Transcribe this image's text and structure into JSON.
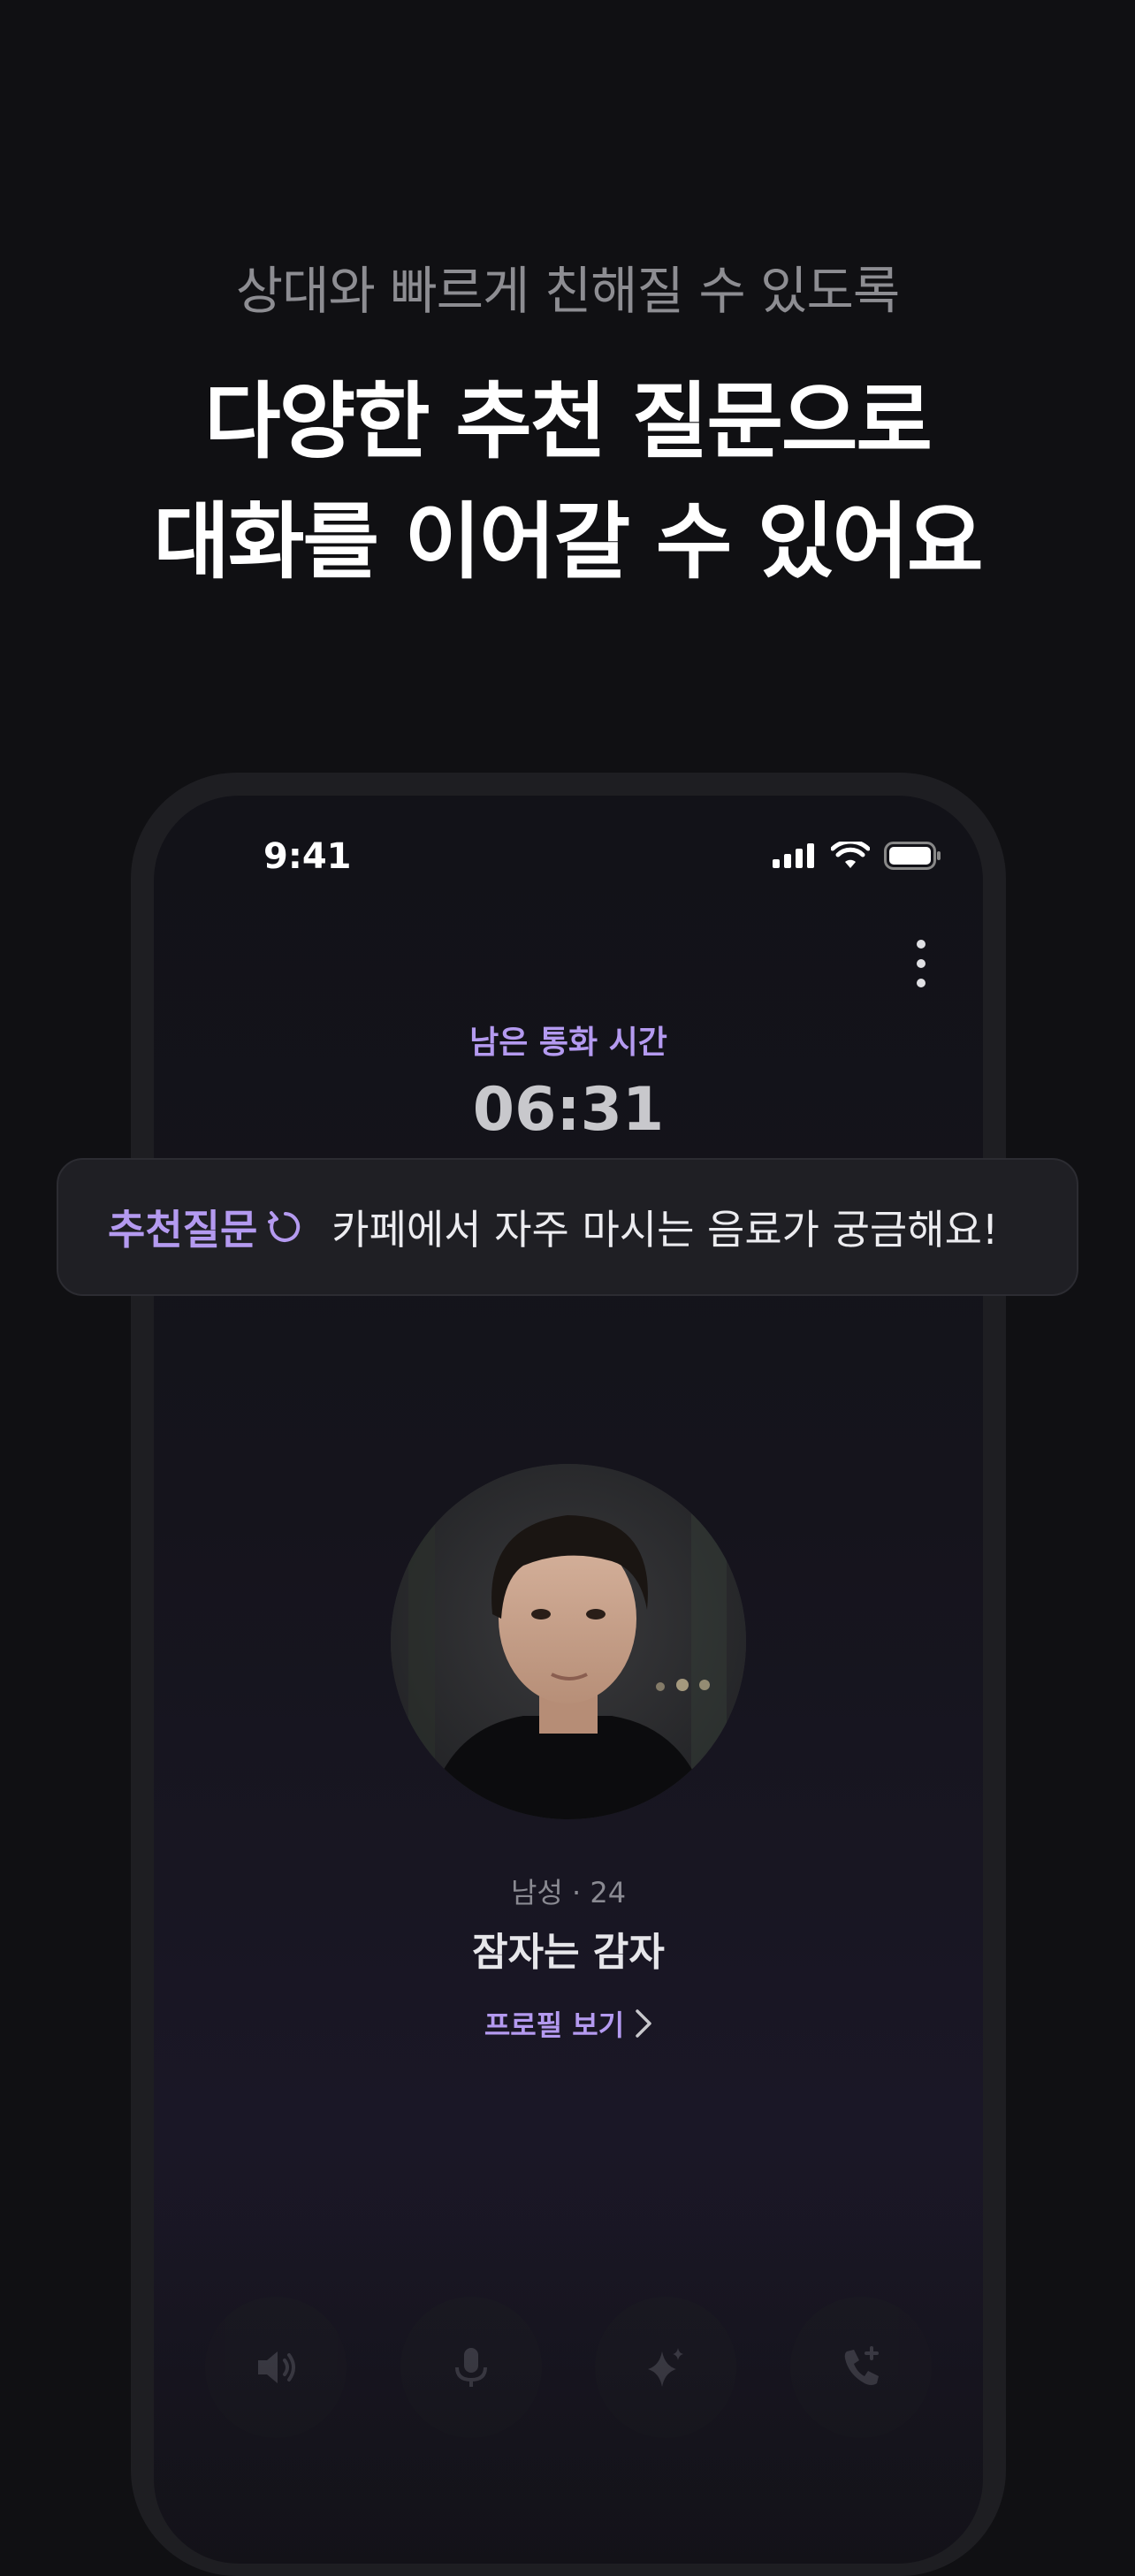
{
  "promo": {
    "subtitle": "상대와 빠르게 친해질 수 있도록",
    "title_line1": "다양한 추천 질문으로",
    "title_line2": "대화를 이어갈 수 있어요"
  },
  "status_bar": {
    "time": "9:41"
  },
  "call": {
    "remaining_label": "남은 통화 시간",
    "remaining_time": "06:31"
  },
  "suggestion": {
    "tag": "추천질문",
    "question": "카페에서 자주 마시는 음료가 궁금해요!"
  },
  "profile": {
    "meta": "남성 · 24",
    "name": "잠자는 감자",
    "link_label": "프로필 보기"
  },
  "controls": [
    {
      "icon": "speaker-icon"
    },
    {
      "icon": "microphone-icon"
    },
    {
      "icon": "sparkle-icon"
    },
    {
      "icon": "add-call-icon"
    }
  ],
  "colors": {
    "background": "#101013",
    "accent": "#b49af0",
    "banner": "#1f1f24"
  }
}
